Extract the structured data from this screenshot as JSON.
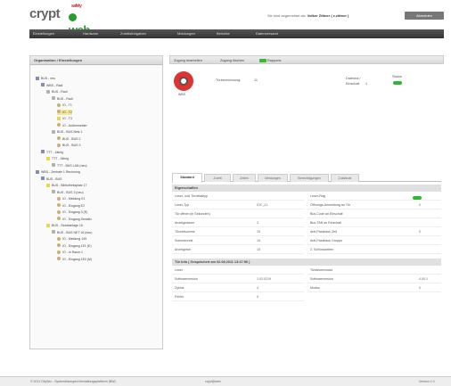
{
  "header": {
    "logo_text": "crypt",
    "logo_sup": "safety",
    "logo_web": "web",
    "login_info_prefix": "Sie sind angemeldet als:",
    "login_user": "Volker Zittner ( z.zittner )",
    "logout_label": "Abmelden"
  },
  "navbar": {
    "items": [
      "Einstellungen",
      "Hardware",
      "Zutrittsfreigaben",
      "Meldungen",
      "Berichte",
      "Datenversand"
    ]
  },
  "left_panel": {
    "title": "Organisation / Einstellungen",
    "tree": [
      "BUS - neu",
      "WBS - Radl",
      "BUS - Radl",
      "BUS - Radl",
      "IO - T1",
      "IO - T2",
      "IO - T3",
      "IO - Außenmelder",
      "BUS - BUS Netz 1",
      "BUS - BUS 2",
      "BUS - BUS 3",
      "TTT - Jährig",
      "TTT - Jährig",
      "TTT - BUS LAN (neu)",
      "WBS - Zentrale 1 Rechnung",
      "BUS - BUS",
      "BUS - Bibliotheksplatz 17",
      "BUS - BUS 3 (neu)",
      "IO - Meldung E1",
      "IO - Eingang E2",
      "IO - Eingang 3 (E)",
      "IO - Eingang Sensitiv",
      "BUS - Strahlanlage 16",
      "BUS - BUS NET 16 (neu)",
      "IO - Meldung 149",
      "IO - Eingang 1E1 (E)",
      "IO - In Raum 1",
      "IO - Eingang 1E0 (M)"
    ]
  },
  "toolbar": {
    "items": [
      "Zugang bearbeiten",
      "Zugang löschen",
      "Rapports"
    ]
  },
  "device": {
    "label": "WBS",
    "field1_label": "Türbezeichnung:",
    "field1_value": "11",
    "field2_label": "Datenna /",
    "field2_label2": "Einschalt",
    "field2_value": "1",
    "status_label": "Status"
  },
  "tabs": [
    "Standard",
    "Zutritt",
    "Zeiten",
    "Meldungen",
    "Berechtigungen",
    "Zustände"
  ],
  "props": {
    "section_title": "Eigenschaften",
    "left_rows": [
      {
        "k": "Leser- und Türdetailtyp",
        "v": ""
      },
      {
        "k": "Leser-Typ",
        "v": "IOC_21"
      },
      {
        "k": "Tür öffnen (in Sekunden)",
        "v": ""
      },
      {
        "k": "Anzeigedauer",
        "v": "3"
      },
      {
        "k": "Türzeitsumme",
        "v": "15"
      },
      {
        "k": "Summenrest",
        "v": "15"
      },
      {
        "k": "Anzeigeton",
        "v": "15"
      }
    ],
    "right_rows": [
      {
        "k": "Leser-Flag",
        "v": ""
      },
      {
        "k": "Öffnungs-Anmeldung an Tür",
        "v": "0"
      },
      {
        "k": "Bus-Code an Einschalt",
        "v": ""
      },
      {
        "k": "Bus-TAN an Einschalt",
        "v": ""
      },
      {
        "k": "Anti-Passback Zeit",
        "v": "0"
      },
      {
        "k": "Anti-Passback Gruppe",
        "v": ""
      },
      {
        "k": "2. Schlosszeiten",
        "v": ""
      }
    ]
  },
  "status_section": {
    "title": "Tür Info ( Gespeichert am 02.08.2011 13:47:56 )",
    "left_rows": [
      {
        "k": "Leser",
        "v": ""
      },
      {
        "k": "Softwareversion",
        "v": "1:03.0219"
      },
      {
        "k": "Zyklus",
        "v": "4"
      },
      {
        "k": "Fehler",
        "v": "0"
      }
    ],
    "right_rows": [
      {
        "k": "Türsteuermodul",
        "v": ""
      },
      {
        "k": "Softwareversion",
        "v": "4.00.1"
      },
      {
        "k": "Modus",
        "v": "0"
      }
    ]
  },
  "statusbar": {
    "left": "© 2011 CitySec - Systemlösungen/Verwaltungsplattform (BW)",
    "left2": "crypt@web",
    "right": "Version 1.0"
  },
  "colors": {
    "accent_green": "#2eb82e",
    "nav_bg": "#444444",
    "alarm_red": "#dd3333"
  }
}
